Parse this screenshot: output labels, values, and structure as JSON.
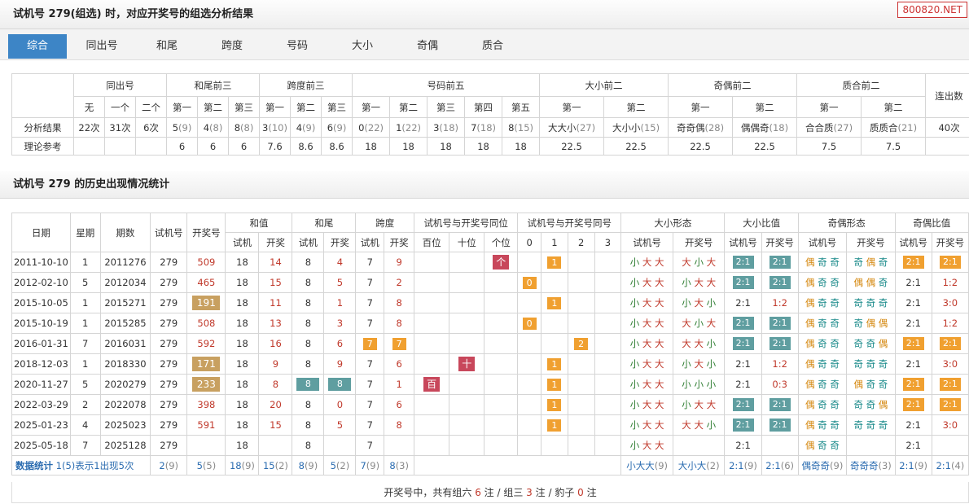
{
  "header1": {
    "title": "试机号 279(组选) 时，对应开奖号的组选分析结果",
    "watermark": "800820.NET"
  },
  "tabs": [
    "综合",
    "同出号",
    "和尾",
    "跨度",
    "号码",
    "大小",
    "奇偶",
    "质合"
  ],
  "summary": {
    "groups": [
      "同出号",
      "和尾前三",
      "跨度前三",
      "号码前五",
      "大小前二",
      "奇偶前二",
      "质合前二",
      "连出数"
    ],
    "sub": [
      "无",
      "一个",
      "二个",
      "第一",
      "第二",
      "第三",
      "第一",
      "第二",
      "第三",
      "第一",
      "第二",
      "第三",
      "第四",
      "第五",
      "第一",
      "第二",
      "第一",
      "第二",
      "第一",
      "第二"
    ],
    "row1_label": "分析结果",
    "row1": [
      [
        "22次",
        ""
      ],
      [
        "31次",
        ""
      ],
      [
        "6次",
        ""
      ],
      [
        "5",
        "(9)"
      ],
      [
        "4",
        "(8)"
      ],
      [
        "8",
        "(8)"
      ],
      [
        "3",
        "(10)"
      ],
      [
        "4",
        "(9)"
      ],
      [
        "6",
        "(9)"
      ],
      [
        "0",
        "(22)"
      ],
      [
        "1",
        "(22)"
      ],
      [
        "3",
        "(18)"
      ],
      [
        "7",
        "(18)"
      ],
      [
        "8",
        "(15)"
      ],
      [
        "大大小",
        "(27)"
      ],
      [
        "大小小",
        "(15)"
      ],
      [
        "奇奇偶",
        "(28)"
      ],
      [
        "偶偶奇",
        "(18)"
      ],
      [
        "合合质",
        "(27)"
      ],
      [
        "质质合",
        "(21)"
      ],
      [
        "40次",
        ""
      ]
    ],
    "row2_label": "理论参考",
    "row2": [
      "",
      "",
      "",
      "6",
      "6",
      "6",
      "7.6",
      "8.6",
      "8.6",
      "18",
      "18",
      "18",
      "18",
      "18",
      "22.5",
      "22.5",
      "22.5",
      "22.5",
      "7.5",
      "7.5",
      ""
    ]
  },
  "header2": {
    "title": "试机号 279 的历史出现情况统计"
  },
  "history": {
    "h_date": "日期",
    "h_week": "星期",
    "h_issue": "期数",
    "h_try": "试机号",
    "h_draw": "开奖号",
    "groups": [
      "和值",
      "和尾",
      "跨度",
      "试机号与开奖号同位",
      "试机号与开奖号同号",
      "大小形态",
      "大小比值",
      "奇偶形态",
      "奇偶比值"
    ],
    "sub": [
      "试机",
      "开奖",
      "试机",
      "开奖",
      "试机",
      "开奖",
      "百位",
      "十位",
      "个位",
      "0",
      "1",
      "2",
      "3",
      "试机号",
      "开奖号",
      "试机号",
      "开奖号",
      "试机号",
      "开奖号",
      "试机号",
      "开奖号"
    ],
    "rows": [
      {
        "date": "2011-10-10",
        "week": "1",
        "issue": "2011276",
        "try": "279",
        "draw": "509",
        "drawHL": false,
        "sh": "18",
        "kh": "14",
        "sw": "8",
        "kw": "4",
        "swHL": false,
        "kwHL": false,
        "sk": "7",
        "kk": "9",
        "skHL": false,
        "kkHL": false,
        "pos": [
          "",
          "",
          "个"
        ],
        "same": [
          "",
          "1",
          "",
          ""
        ],
        "dxS": "小大大",
        "dxK": "大小大",
        "dbS": "2:1",
        "dbK": "2:1",
        "dbSHL": true,
        "dbKHL": true,
        "joS": "偶奇奇",
        "joK": "奇偶奇",
        "jbS": "2:1",
        "jbK": "2:1",
        "jbSHL": true,
        "jbKHL": true
      },
      {
        "date": "2012-02-10",
        "week": "5",
        "issue": "2012034",
        "try": "279",
        "draw": "465",
        "drawHL": false,
        "sh": "18",
        "kh": "15",
        "sw": "8",
        "kw": "5",
        "swHL": false,
        "kwHL": false,
        "sk": "7",
        "kk": "2",
        "skHL": false,
        "kkHL": false,
        "pos": [
          "",
          "",
          ""
        ],
        "same": [
          "0",
          "",
          "",
          ""
        ],
        "dxS": "小大大",
        "dxK": "小大大",
        "dbS": "2:1",
        "dbK": "2:1",
        "dbSHL": true,
        "dbKHL": true,
        "joS": "偶奇奇",
        "joK": "偶偶奇",
        "jbS": "2:1",
        "jbK": "1:2",
        "jbSHL": false,
        "jbKHL": false
      },
      {
        "date": "2015-10-05",
        "week": "1",
        "issue": "2015271",
        "try": "279",
        "draw": "191",
        "drawHL": true,
        "sh": "18",
        "kh": "11",
        "sw": "8",
        "kw": "1",
        "swHL": false,
        "kwHL": false,
        "sk": "7",
        "kk": "8",
        "skHL": false,
        "kkHL": false,
        "pos": [
          "",
          "",
          ""
        ],
        "same": [
          "",
          "1",
          "",
          ""
        ],
        "dxS": "小大大",
        "dxK": "小大小",
        "dbS": "2:1",
        "dbK": "1:2",
        "dbSHL": false,
        "dbKHL": false,
        "joS": "偶奇奇",
        "joK": "奇奇奇",
        "jbS": "2:1",
        "jbK": "3:0",
        "jbSHL": false,
        "jbKHL": false
      },
      {
        "date": "2015-10-19",
        "week": "1",
        "issue": "2015285",
        "try": "279",
        "draw": "508",
        "drawHL": false,
        "sh": "18",
        "kh": "13",
        "sw": "8",
        "kw": "3",
        "swHL": false,
        "kwHL": false,
        "sk": "7",
        "kk": "8",
        "skHL": false,
        "kkHL": false,
        "pos": [
          "",
          "",
          ""
        ],
        "same": [
          "0",
          "",
          "",
          ""
        ],
        "dxS": "小大大",
        "dxK": "大小大",
        "dbS": "2:1",
        "dbK": "2:1",
        "dbSHL": true,
        "dbKHL": true,
        "joS": "偶奇奇",
        "joK": "奇偶偶",
        "jbS": "2:1",
        "jbK": "1:2",
        "jbSHL": false,
        "jbKHL": false
      },
      {
        "date": "2016-01-31",
        "week": "7",
        "issue": "2016031",
        "try": "279",
        "draw": "592",
        "drawHL": false,
        "sh": "18",
        "kh": "16",
        "sw": "8",
        "kw": "6",
        "swHL": false,
        "kwHL": false,
        "sk": "7",
        "kk": "7",
        "skHL": true,
        "kkHL": true,
        "pos": [
          "",
          "",
          ""
        ],
        "same": [
          "",
          "",
          "2",
          ""
        ],
        "dxS": "小大大",
        "dxK": "大大小",
        "dbS": "2:1",
        "dbK": "2:1",
        "dbSHL": true,
        "dbKHL": true,
        "joS": "偶奇奇",
        "joK": "奇奇偶",
        "jbS": "2:1",
        "jbK": "2:1",
        "jbSHL": true,
        "jbKHL": true
      },
      {
        "date": "2018-12-03",
        "week": "1",
        "issue": "2018330",
        "try": "279",
        "draw": "171",
        "drawHL": true,
        "sh": "18",
        "kh": "9",
        "sw": "8",
        "kw": "9",
        "swHL": false,
        "kwHL": false,
        "sk": "7",
        "kk": "6",
        "skHL": false,
        "kkHL": false,
        "pos": [
          "",
          "十",
          ""
        ],
        "same": [
          "",
          "1",
          "",
          ""
        ],
        "dxS": "小大大",
        "dxK": "小大小",
        "dbS": "2:1",
        "dbK": "1:2",
        "dbSHL": false,
        "dbKHL": false,
        "joS": "偶奇奇",
        "joK": "奇奇奇",
        "jbS": "2:1",
        "jbK": "3:0",
        "jbSHL": false,
        "jbKHL": false
      },
      {
        "date": "2020-11-27",
        "week": "5",
        "issue": "2020279",
        "try": "279",
        "draw": "233",
        "drawHL": true,
        "sh": "18",
        "kh": "8",
        "sw": "8",
        "kw": "8",
        "swHL": true,
        "kwHL": true,
        "sk": "7",
        "kk": "1",
        "skHL": false,
        "kkHL": false,
        "pos": [
          "百",
          "",
          ""
        ],
        "same": [
          "",
          "1",
          "",
          ""
        ],
        "dxS": "小大大",
        "dxK": "小小小",
        "dbS": "2:1",
        "dbK": "0:3",
        "dbSHL": false,
        "dbKHL": false,
        "joS": "偶奇奇",
        "joK": "偶奇奇",
        "jbS": "2:1",
        "jbK": "2:1",
        "jbSHL": true,
        "jbKHL": true
      },
      {
        "date": "2022-03-29",
        "week": "2",
        "issue": "2022078",
        "try": "279",
        "draw": "398",
        "drawHL": false,
        "sh": "18",
        "kh": "20",
        "sw": "8",
        "kw": "0",
        "swHL": false,
        "kwHL": false,
        "sk": "7",
        "kk": "6",
        "skHL": false,
        "kkHL": false,
        "pos": [
          "",
          "",
          ""
        ],
        "same": [
          "",
          "1",
          "",
          ""
        ],
        "dxS": "小大大",
        "dxK": "小大大",
        "dbS": "2:1",
        "dbK": "2:1",
        "dbSHL": true,
        "dbKHL": true,
        "joS": "偶奇奇",
        "joK": "奇奇偶",
        "jbS": "2:1",
        "jbK": "2:1",
        "jbSHL": true,
        "jbKHL": true
      },
      {
        "date": "2025-01-23",
        "week": "4",
        "issue": "2025023",
        "try": "279",
        "draw": "591",
        "drawHL": false,
        "sh": "18",
        "kh": "15",
        "sw": "8",
        "kw": "5",
        "swHL": false,
        "kwHL": false,
        "sk": "7",
        "kk": "8",
        "skHL": false,
        "kkHL": false,
        "pos": [
          "",
          "",
          ""
        ],
        "same": [
          "",
          "1",
          "",
          ""
        ],
        "dxS": "小大大",
        "dxK": "大大小",
        "dbS": "2:1",
        "dbK": "2:1",
        "dbSHL": true,
        "dbKHL": true,
        "joS": "偶奇奇",
        "joK": "奇奇奇",
        "jbS": "2:1",
        "jbK": "3:0",
        "jbSHL": false,
        "jbKHL": false
      },
      {
        "date": "2025-05-18",
        "week": "7",
        "issue": "2025128",
        "try": "279",
        "draw": "",
        "drawHL": false,
        "sh": "18",
        "kh": "",
        "sw": "8",
        "kw": "",
        "swHL": false,
        "kwHL": false,
        "sk": "7",
        "kk": "",
        "skHL": false,
        "kkHL": false,
        "pos": [
          "",
          "",
          ""
        ],
        "same": [
          "",
          "",
          "",
          ""
        ],
        "dxS": "小大大",
        "dxK": "",
        "dbS": "2:1",
        "dbK": "",
        "dbSHL": false,
        "dbKHL": false,
        "joS": "偶奇奇",
        "joK": "",
        "jbS": "2:1",
        "jbK": "",
        "jbSHL": false,
        "jbKHL": false
      }
    ],
    "stats": {
      "label": "数据统计",
      "note": "1(5)表示1出现5次",
      "cells": [
        [
          "2",
          "(9)"
        ],
        [
          "5",
          "(5)"
        ],
        [
          "18",
          "(9)"
        ],
        [
          "15",
          "(2)"
        ],
        [
          "8",
          "(9)"
        ],
        [
          "5",
          "(2)"
        ],
        [
          "7",
          "(9)"
        ],
        [
          "8",
          "(3)"
        ],
        [
          "小大大",
          "(9)"
        ],
        [
          "大小大",
          "(2)"
        ],
        [
          "2:1",
          "(9)"
        ],
        [
          "2:1",
          "(6)"
        ],
        [
          "偶奇奇",
          "(9)"
        ],
        [
          "奇奇奇",
          "(3)"
        ],
        [
          "2:1",
          "(9)"
        ],
        [
          "2:1",
          "(4)"
        ]
      ]
    }
  },
  "footer": {
    "prefix": "开奖号中，共有组六",
    "n6": "6",
    "t6": "注 / 组三",
    "n3": "3",
    "t3": "注 / 豹子",
    "n0": "0",
    "t0": "注"
  },
  "colors": {
    "tab_active": "#3d85c6",
    "orange": "#f0a030",
    "teal": "#5f9ea0",
    "red_badge": "#c8475b"
  }
}
